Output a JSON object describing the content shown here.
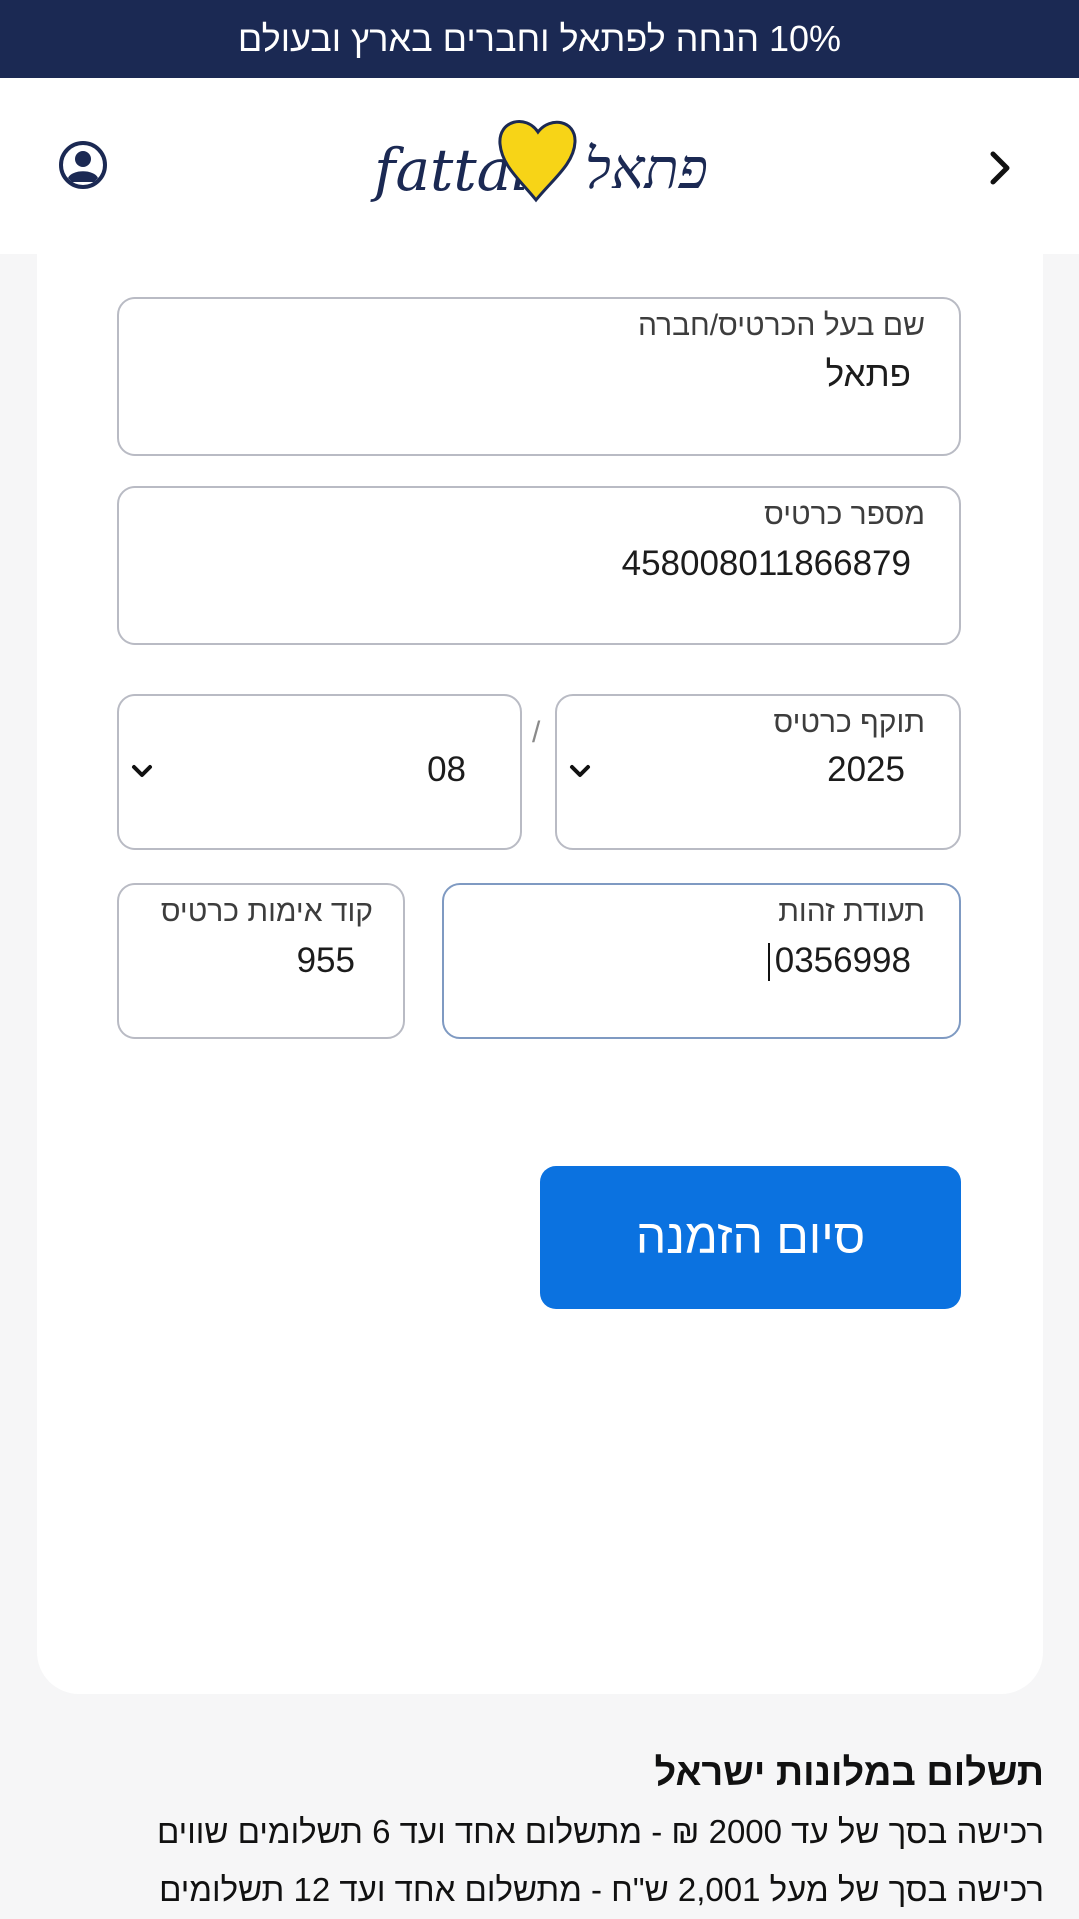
{
  "banner": {
    "text": "10% הנחה לפתאל וחברים בארץ ובעולם"
  },
  "header": {
    "logo_text_latin": "fattal",
    "logo_text_hebrew": "פתאל",
    "logo_heart_color": "#f7d417",
    "logo_ink_color": "#1b2953",
    "user_icon": "user-circle-icon",
    "back_icon": "chevron-right-icon"
  },
  "form": {
    "cardholder": {
      "label": "שם בעל הכרטיס/חברה",
      "value": "פתאל"
    },
    "card_number": {
      "label": "מספר כרטיס",
      "value": "458008011866879"
    },
    "expiry": {
      "label": "תוקף כרטיס",
      "year": "2025",
      "month": "08",
      "separator": "/"
    },
    "id_number": {
      "label": "תעודת זהות",
      "value": "0356998"
    },
    "cvv": {
      "label": "קוד אימות כרטיס",
      "value": "955"
    },
    "submit_label": "סיום הזמנה",
    "accent_color": "#0b72e0"
  },
  "info": {
    "title": "תשלום במלונות ישראל",
    "lines": [
      "רכישה בסך של עד 2000 ₪ - מתשלום אחד ועד 6 תשלומים שווים",
      "רכישה בסך של מעל 2,001 ש\"ח  - מתשלום אחד ועד 12 תשלומים"
    ]
  }
}
